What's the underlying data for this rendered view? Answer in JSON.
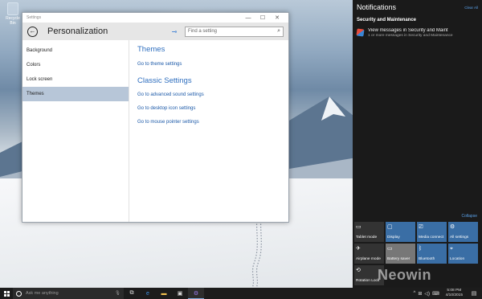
{
  "desktop": {
    "recycle_bin_label": "Recycle Bin"
  },
  "settings_window": {
    "title": "Settings",
    "controls": {
      "minimize": "—",
      "maximize": "☐",
      "close": "✕"
    },
    "header_title": "Personalization",
    "search_placeholder": "Find a setting",
    "nav_items": [
      {
        "label": "Background"
      },
      {
        "label": "Colors"
      },
      {
        "label": "Lock screen"
      },
      {
        "label": "Themes"
      }
    ],
    "selected_nav": "Themes",
    "content": {
      "themes_heading": "Themes",
      "themes_link": "Go to theme settings",
      "classic_heading": "Classic Settings",
      "classic_links": [
        "Go to advanced sound settings",
        "Go to desktop icon settings",
        "Go to mouse pointer settings"
      ]
    }
  },
  "action_center": {
    "title": "Notifications",
    "clear_all": "Clear All",
    "group": "Security and Maintenance",
    "notification": {
      "title": "View messages in Security and Maint",
      "body": "1 or more messages in Security and Maintenance"
    },
    "collapse_label": "Collapse",
    "tiles": [
      {
        "label": "Tablet mode",
        "icon": "tablet-icon",
        "state": "off"
      },
      {
        "label": "Display",
        "icon": "display-icon",
        "state": "on"
      },
      {
        "label": "Media connect",
        "icon": "media-connect-icon",
        "state": "on"
      },
      {
        "label": "All settings",
        "icon": "gear-icon",
        "state": "on"
      },
      {
        "label": "Airplane mode",
        "icon": "airplane-icon",
        "state": "off"
      },
      {
        "label": "Battery saver",
        "icon": "battery-icon",
        "state": "disabled"
      },
      {
        "label": "Bluetooth",
        "icon": "bluetooth-icon",
        "state": "on"
      },
      {
        "label": "Location",
        "icon": "location-icon",
        "state": "on"
      },
      {
        "label": "Rotation Lock",
        "icon": "rotation-lock-icon",
        "state": "off"
      }
    ]
  },
  "taskbar": {
    "search_placeholder": "Ask me anything",
    "time": "5:08 PM",
    "date": "4/10/2015",
    "pinned": [
      {
        "name": "task-view-icon"
      },
      {
        "name": "edge-browser-icon"
      },
      {
        "name": "file-explorer-icon"
      },
      {
        "name": "store-icon"
      },
      {
        "name": "settings-app-icon"
      }
    ]
  },
  "watermark": "Neowin",
  "colors": {
    "accent_blue": "#2f6fbf",
    "link_blue": "#1b59a8",
    "nav_selected": "#b7c6d8",
    "tile_on": "#3a6ea5",
    "action_center_bg": "#1a1a1a"
  }
}
